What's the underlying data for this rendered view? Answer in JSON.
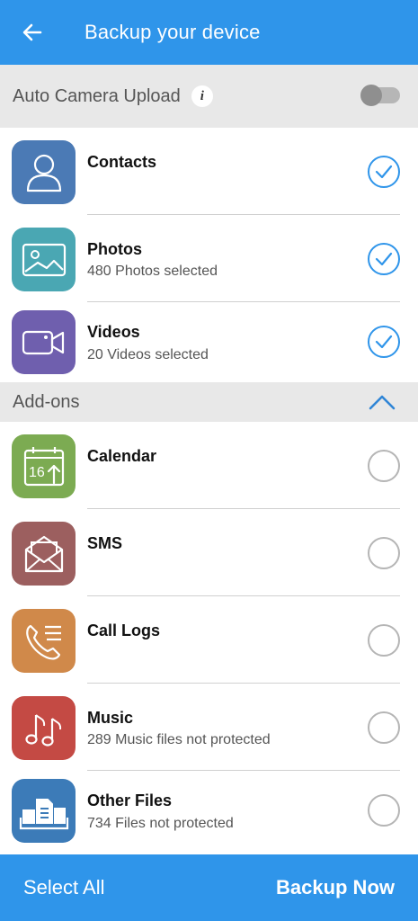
{
  "header": {
    "title": "Backup your device",
    "back_icon": "arrow-left-icon"
  },
  "auto_upload": {
    "label": "Auto Camera Upload",
    "info_glyph": "i",
    "enabled": false
  },
  "items": [
    {
      "title": "Contacts",
      "subtitle": "",
      "selected": true,
      "icon": "person-icon",
      "color": "#4b7ab5"
    },
    {
      "title": "Photos",
      "subtitle": "480 Photos selected",
      "selected": true,
      "icon": "photo-icon",
      "color": "#4aa7b3"
    },
    {
      "title": "Videos",
      "subtitle": "20 Videos selected",
      "selected": true,
      "icon": "video-camera-icon",
      "color": "#6f5fae"
    }
  ],
  "addons": {
    "label": "Add-ons",
    "items": [
      {
        "title": "Calendar",
        "subtitle": "",
        "selected": false,
        "icon": "calendar-icon",
        "color": "#7cab52",
        "icon_text": "16"
      },
      {
        "title": "SMS",
        "subtitle": "",
        "selected": false,
        "icon": "envelope-icon",
        "color": "#9c5f5f"
      },
      {
        "title": "Call Logs",
        "subtitle": "",
        "selected": false,
        "icon": "phone-icon",
        "color": "#d0894a"
      },
      {
        "title": "Music",
        "subtitle": "289 Music files not protected",
        "selected": false,
        "icon": "music-note-icon",
        "color": "#c44a44"
      },
      {
        "title": "Other Files",
        "subtitle": "734 Files not protected",
        "selected": false,
        "icon": "files-icon",
        "color": "#3c7bb8"
      }
    ]
  },
  "footer": {
    "select_all": "Select All",
    "backup_now": "Backup Now"
  },
  "colors": {
    "accent": "#2f95ea",
    "section_bg": "#e8e8e8"
  }
}
